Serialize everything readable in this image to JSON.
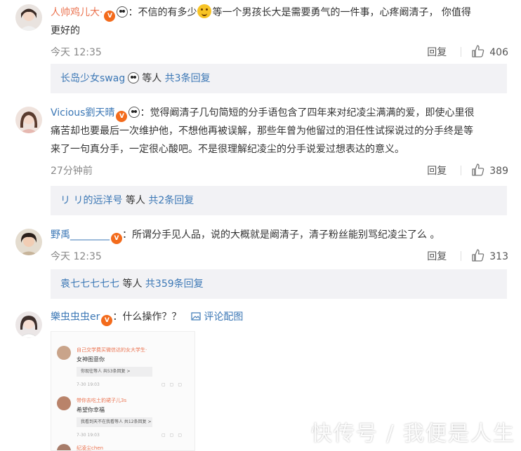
{
  "comments": [
    {
      "username": "人帅鸡儿大·",
      "text_a": "：不信的有多少",
      "text_b": "等一个男孩长大是需要勇气的一件事，心疼阚清子， 你值得",
      "text_c": "更好的",
      "time": "今天 12:35",
      "reply_label": "回复",
      "likes": "406",
      "replies": {
        "user": "长岛少女swag",
        "suffix": "等人",
        "count_link": "共3条回复"
      }
    },
    {
      "username": "Vicious劉天晴",
      "line1": "：觉得阚清子几句简短的分手语包含了四年来对纪凌尘满满的爱，即使心里很",
      "line2": "痛苦却也要最后一次维护他，不想他再被误解，那些年曾为他留过的泪任性试探说过的分手终是等",
      "line3": "来了一句真分手，一定很心酸吧。不是很理解纪凌尘的分手说爱过想表达的意义。",
      "time": "27分钟前",
      "reply_label": "回复",
      "likes": "389",
      "replies": {
        "user": "リ リ的远洋号",
        "suffix": "等人",
        "count_link": "共2条回复"
      }
    },
    {
      "username": "野禹________",
      "text": "：所谓分手见人品，说的大概就是阚清子，清子粉丝能别骂纪凌尘了么 。",
      "time": "今天 12:35",
      "reply_label": "回复",
      "likes": "313",
      "replies": {
        "user": "袁七七七七七",
        "suffix": "等人",
        "count_link": "共359条回复"
      }
    },
    {
      "username": "樂虫虫虫er",
      "text": "：什么操作？？",
      "pic_link": "评论配图"
    }
  ],
  "thumbnail": {
    "rows": [
      {
        "name": "自己交学费买微信达的女大学生·",
        "text": "女神图意你",
        "box": "你现往等人 共53条回复 >",
        "time": "7-30 19:03"
      },
      {
        "name": "带你去吃土豹裙子儿3s",
        "text": "希望你幸福",
        "box": "我看到天不在我看等人 共12条回复 >",
        "time": "7-30 19:03"
      },
      {
        "name": "纪凌尘chen",
        "text": "",
        "box": "",
        "time": ""
      }
    ]
  },
  "watermark": "快传号 / 我便是人生",
  "colors": {
    "username": "#eb7350",
    "link": "#3b77b5",
    "reply_bg": "#f2f2f5",
    "meta": "#888888"
  },
  "icons": [
    "thumbs-up-icon",
    "image-icon",
    "vip-badge-icon",
    "panda-badge-icon",
    "smiley-emoji-icon"
  ]
}
